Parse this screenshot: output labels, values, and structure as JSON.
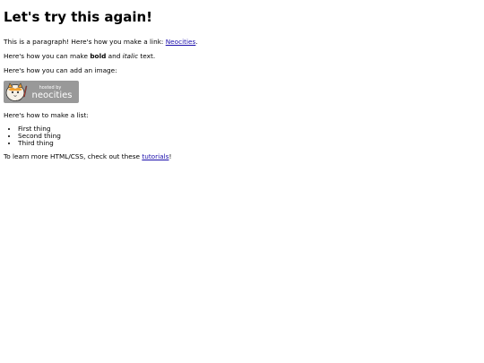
{
  "heading": "Let's try this again!",
  "para_link": {
    "before": "This is a paragraph! Here's how you make a link: ",
    "link_text": "Neocities",
    "after": "."
  },
  "para_format": {
    "before": "Here's how you can make ",
    "bold": "bold",
    "middle": " and ",
    "italic": "italic",
    "after": " text."
  },
  "para_image": "Here's how you can add an image:",
  "badge": {
    "small_text": "hosted by",
    "brand_text": "neocities"
  },
  "para_list": "Here's how to make a list:",
  "list_items": [
    "First thing",
    "Second thing",
    "Third thing"
  ],
  "para_learn": {
    "before": "To learn more HTML/CSS, check out these ",
    "link_text": "tutorials",
    "after": "!"
  },
  "colors": {
    "link": "#1a0dab",
    "badge_bg": "#999999",
    "badge_text": "#ffffff",
    "cat_orange": "#f0a030"
  }
}
